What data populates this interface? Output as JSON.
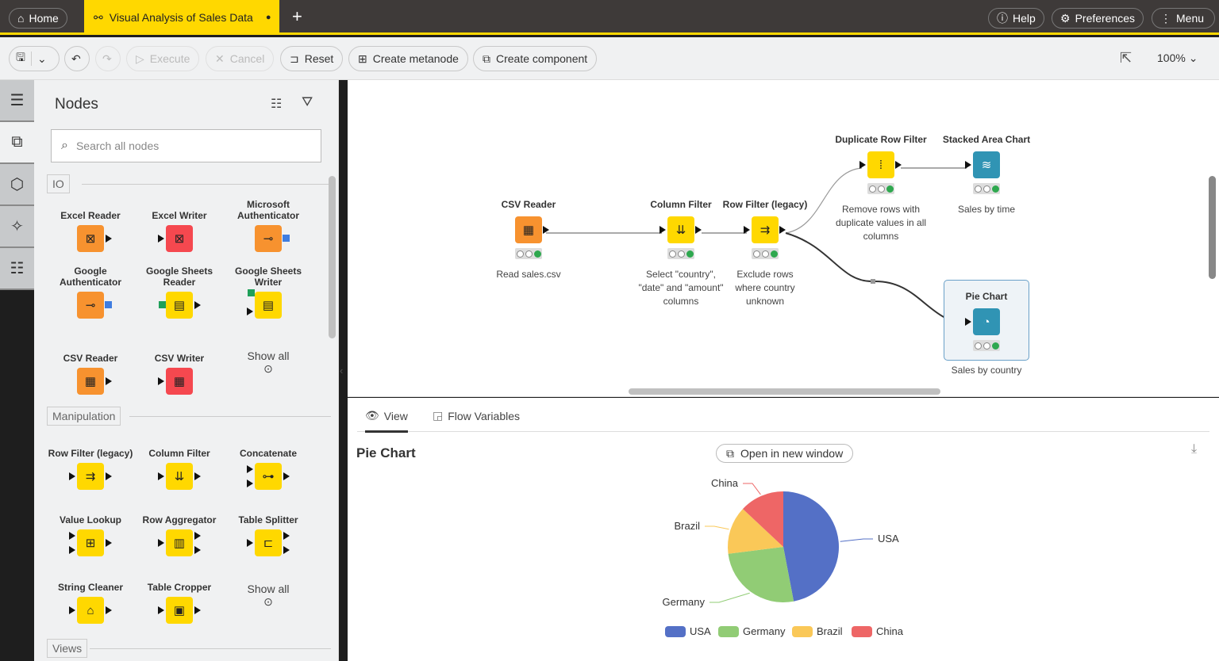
{
  "topbar": {
    "home_label": "Home",
    "tab_title": "Visual Analysis of Sales Data",
    "tab_modified_dot": "●",
    "new_tab": "+",
    "help_label": "Help",
    "preferences_label": "Preferences",
    "menu_label": "Menu"
  },
  "toolbar": {
    "execute_label": "Execute",
    "cancel_label": "Cancel",
    "reset_label": "Reset",
    "create_metanode_label": "Create metanode",
    "create_component_label": "Create component",
    "zoom_level": "100%"
  },
  "sidebar": {
    "title": "Nodes",
    "search_placeholder": "Search all nodes",
    "categories": [
      {
        "name": "IO",
        "nodes": [
          "Excel Reader",
          "Excel Writer",
          "Microsoft Authenticator",
          "Google Authenticator",
          "Google Sheets Reader",
          "Google Sheets Writer",
          "CSV Reader",
          "CSV Writer"
        ],
        "show_all": "Show all"
      },
      {
        "name": "Manipulation",
        "nodes": [
          "Row Filter (legacy)",
          "Column Filter",
          "Concatenate",
          "Value Lookup",
          "Row Aggregator",
          "Table Splitter",
          "String Cleaner",
          "Table Cropper"
        ],
        "show_all": "Show all"
      },
      {
        "name": "Views"
      }
    ]
  },
  "workflow": {
    "nodes": [
      {
        "title": "CSV Reader",
        "desc": "Read sales.csv",
        "color": "#f7922f"
      },
      {
        "title": "Column Filter",
        "desc": "Select \"country\", \"date\" and \"amount\" columns",
        "color": "#ffd800"
      },
      {
        "title": "Row Filter (legacy)",
        "desc": "Exclude rows where country unknown",
        "color": "#ffd800"
      },
      {
        "title": "Duplicate Row Filter",
        "desc": "Remove rows with duplicate values in all columns",
        "color": "#ffd800"
      },
      {
        "title": "Stacked Area Chart",
        "desc": "Sales by time",
        "color": "#3094b4"
      },
      {
        "title": "Pie Chart",
        "desc": "Sales by country",
        "color": "#3094b4"
      }
    ]
  },
  "view_panel": {
    "tab_view": "View",
    "tab_flow_variables": "Flow Variables",
    "title": "Pie Chart",
    "open_new_window": "Open in new window"
  },
  "chart_data": {
    "type": "pie",
    "title": "Pie Chart",
    "categories": [
      "USA",
      "Germany",
      "Brazil",
      "China"
    ],
    "values": [
      47,
      26,
      14,
      13
    ],
    "colors": [
      "#5470c6",
      "#91cc75",
      "#fac858",
      "#ee6666"
    ],
    "legend": "bottom"
  }
}
